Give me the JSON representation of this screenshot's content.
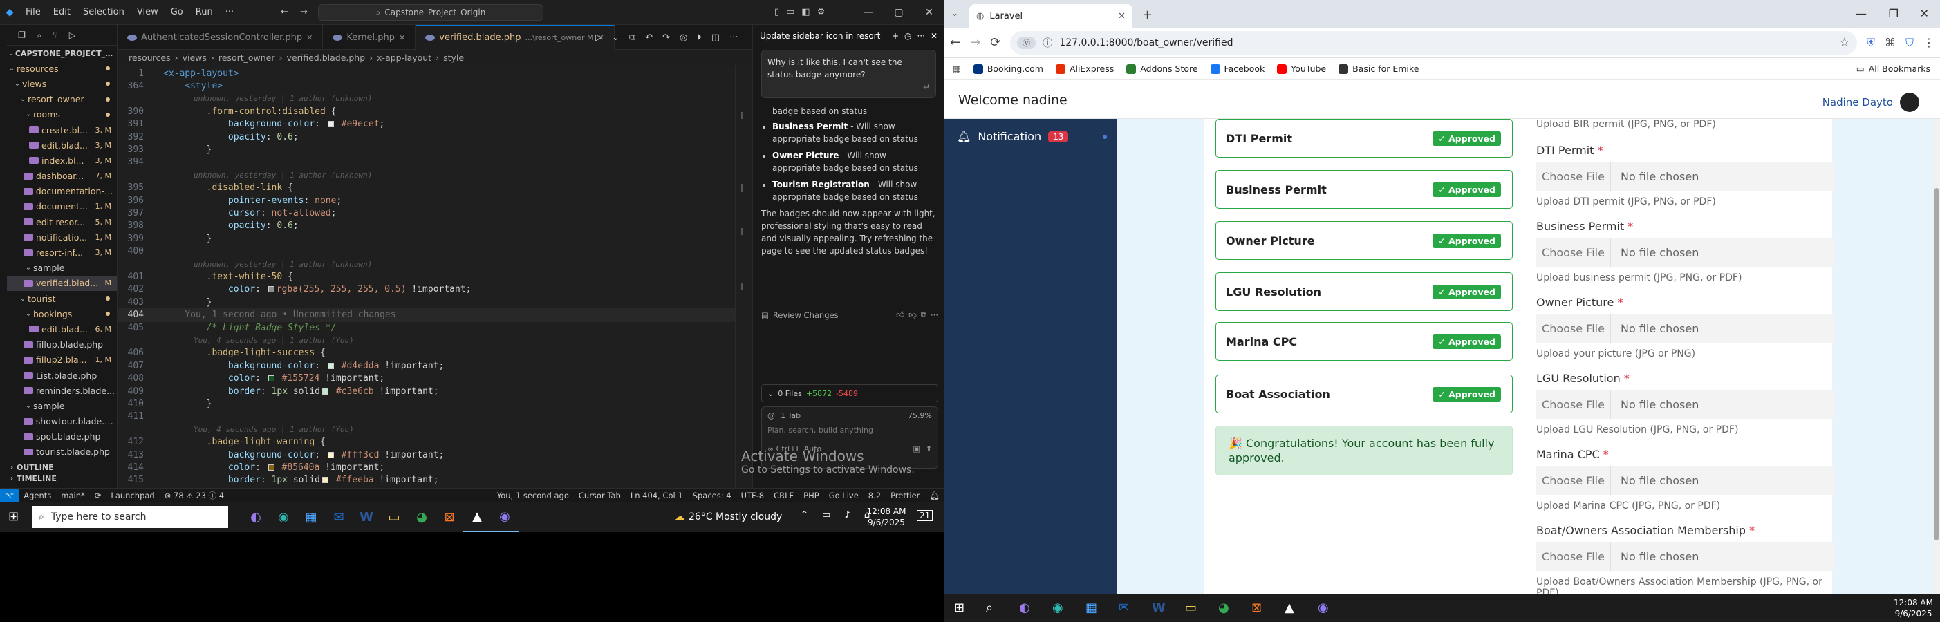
{
  "vscode": {
    "menu": [
      "File",
      "Edit",
      "Selection",
      "View",
      "Go",
      "Run",
      "···"
    ],
    "search": "Capstone_Project_Origin",
    "explorer": {
      "root": "CAPSTONE_PROJECT_ORIG...",
      "rows": [
        {
          "label": "resources",
          "indent": 0,
          "type": "folder",
          "mod": true,
          "badge": ""
        },
        {
          "label": "views",
          "indent": 1,
          "type": "folder",
          "mod": true,
          "badge": ""
        },
        {
          "label": "resort_owner",
          "indent": 2,
          "type": "folder",
          "mod": true,
          "badge": ""
        },
        {
          "label": "rooms",
          "indent": 3,
          "type": "folder",
          "mod": true,
          "badge": ""
        },
        {
          "label": "create.bl...",
          "indent": 4,
          "type": "file",
          "mod": true,
          "badge": "3, M"
        },
        {
          "label": "edit.blad...",
          "indent": 4,
          "type": "file",
          "mod": true,
          "badge": "3, M"
        },
        {
          "label": "index.bl...",
          "indent": 4,
          "type": "file",
          "mod": true,
          "badge": "3, M"
        },
        {
          "label": "dashboar...",
          "indent": 3,
          "type": "file",
          "mod": true,
          "badge": "7, M"
        },
        {
          "label": "documentation-p...",
          "indent": 3,
          "type": "file",
          "mod": true,
          "badge": ""
        },
        {
          "label": "document...",
          "indent": 3,
          "type": "file",
          "mod": true,
          "badge": "1, M"
        },
        {
          "label": "edit-resor...",
          "indent": 3,
          "type": "file",
          "mod": true,
          "badge": "5, M"
        },
        {
          "label": "notificatio...",
          "indent": 3,
          "type": "file",
          "mod": true,
          "badge": "1, M"
        },
        {
          "label": "resort-inf...",
          "indent": 3,
          "type": "file",
          "mod": true,
          "badge": "3, M"
        },
        {
          "label": "sample",
          "indent": 3,
          "type": "folder",
          "mod": false,
          "badge": ""
        },
        {
          "label": "verified.blad...",
          "indent": 3,
          "type": "file",
          "mod": true,
          "badge": "M",
          "active": true
        },
        {
          "label": "tourist",
          "indent": 2,
          "type": "folder",
          "mod": true,
          "badge": ""
        },
        {
          "label": "bookings",
          "indent": 3,
          "type": "folder",
          "mod": true,
          "badge": ""
        },
        {
          "label": "edit.blad...",
          "indent": 4,
          "type": "file",
          "mod": true,
          "badge": "6, M"
        },
        {
          "label": "fillup.blade.php",
          "indent": 3,
          "type": "file",
          "mod": false,
          "badge": ""
        },
        {
          "label": "fillup2.bla...",
          "indent": 3,
          "type": "file",
          "mod": true,
          "badge": "1, M"
        },
        {
          "label": "List.blade.php",
          "indent": 3,
          "type": "file",
          "mod": false,
          "badge": ""
        },
        {
          "label": "reminders.blade...",
          "indent": 3,
          "type": "file",
          "mod": false,
          "badge": ""
        },
        {
          "label": "sample",
          "indent": 3,
          "type": "folder",
          "mod": false,
          "badge": ""
        },
        {
          "label": "showtour.blade.p...",
          "indent": 3,
          "type": "file",
          "mod": false,
          "badge": ""
        },
        {
          "label": "spot.blade.php",
          "indent": 3,
          "type": "file",
          "mod": false,
          "badge": ""
        },
        {
          "label": "tourist.blade.php",
          "indent": 3,
          "type": "file",
          "mod": false,
          "badge": ""
        }
      ],
      "outline": "OUTLINE",
      "timeline": "TIMELINE"
    },
    "tabs": [
      {
        "label": "AuthenticatedSessionController.php",
        "active": false
      },
      {
        "label": "Kernel.php",
        "active": false
      },
      {
        "label": "verified.blade.php",
        "extra": "...\\resort_owner M",
        "active": true
      }
    ],
    "breadcrumb": [
      "resources",
      "views",
      "resort_owner",
      "verified.blade.php",
      "x-app-layout",
      "style"
    ],
    "code": [
      {
        "ln": "1",
        "html": "<span class='c-tag'>&lt;x-app-layout&gt;</span>"
      },
      {
        "ln": "364",
        "html": "    <span class='c-tag'>&lt;style&gt;</span>"
      },
      {
        "ln": "",
        "blame": "unknown, yesterday | 1 author (unknown)"
      },
      {
        "ln": "390",
        "html": "        <span class='c-sel'>.form-control:disabled</span> {"
      },
      {
        "ln": "391",
        "html": "            <span class='c-prop'>background-color</span>: <span class='sw' style='background:#e9ecef'></span> <span class='c-val'>#e9ecef</span>;"
      },
      {
        "ln": "392",
        "html": "            <span class='c-prop'>opacity</span>: <span class='c-num'>0.6</span>;"
      },
      {
        "ln": "393",
        "html": "        }"
      },
      {
        "ln": "394",
        "html": ""
      },
      {
        "ln": "",
        "blame": "unknown, yesterday | 1 author (unknown)"
      },
      {
        "ln": "395",
        "html": "        <span class='c-sel'>.disabled-link</span> {"
      },
      {
        "ln": "396",
        "html": "            <span class='c-prop'>pointer-events</span>: <span class='c-val'>none</span>;"
      },
      {
        "ln": "397",
        "html": "            <span class='c-prop'>cursor</span>: <span class='c-val'>not-allowed</span>;"
      },
      {
        "ln": "398",
        "html": "            <span class='c-prop'>opacity</span>: <span class='c-num'>0.6</span>;"
      },
      {
        "ln": "399",
        "html": "        }"
      },
      {
        "ln": "400",
        "html": ""
      },
      {
        "ln": "",
        "blame": "unknown, yesterday | 1 author (unknown)"
      },
      {
        "ln": "401",
        "html": "        <span class='c-sel'>.text-white-50</span> {"
      },
      {
        "ln": "402",
        "html": "            <span class='c-prop'>color</span>: <span class='sw' style='background:#ffffff80'></span><span class='c-val'>rgba(255, 255, 255, 0.5)</span> !important;"
      },
      {
        "ln": "403",
        "html": "        }"
      },
      {
        "ln": "404",
        "html": "    <span style='color:#6e6e6e'>You, 1 second ago • Uncommitted changes</span>",
        "cur": true
      },
      {
        "ln": "405",
        "html": "        <span class='c-com'>/* Light Badge Styles */</span>"
      },
      {
        "ln": "",
        "blame": "You, 4 seconds ago | 1 author (You)"
      },
      {
        "ln": "406",
        "html": "        <span class='c-sel'>.badge-light-success</span> {"
      },
      {
        "ln": "407",
        "html": "            <span class='c-prop'>background-color</span>: <span class='sw' style='background:#d4edda'></span> <span class='c-val'>#d4edda</span> !important;"
      },
      {
        "ln": "408",
        "html": "            <span class='c-prop'>color</span>: <span class='sw' style='background:#155724'></span> <span class='c-val'>#155724</span> !important;"
      },
      {
        "ln": "409",
        "html": "            <span class='c-prop'>border</span>: <span class='c-num'>1px</span> solid<span class='sw' style='background:#c3e6cb'></span> <span class='c-val'>#c3e6cb</span> !important;"
      },
      {
        "ln": "410",
        "html": "        }"
      },
      {
        "ln": "411",
        "html": ""
      },
      {
        "ln": "",
        "blame": "You, 4 seconds ago | 1 author (You)"
      },
      {
        "ln": "412",
        "html": "        <span class='c-sel'>.badge-light-warning</span> {"
      },
      {
        "ln": "413",
        "html": "            <span class='c-prop'>background-color</span>: <span class='sw' style='background:#fff3cd'></span> <span class='c-val'>#fff3cd</span> !important;"
      },
      {
        "ln": "414",
        "html": "            <span class='c-prop'>color</span>: <span class='sw' style='background:#85640a'></span> <span class='c-val'>#85640a</span> !important;"
      },
      {
        "ln": "415",
        "html": "            <span class='c-prop'>border</span>: <span class='c-num'>1px</span> solid<span class='sw' style='background:#ffeeba'></span> <span class='c-val'>#ffeeba</span> !important;"
      }
    ],
    "chat": {
      "title": "Update sidebar icon in resort",
      "question": "Why is it like this, I can't see the status badge anymore?",
      "lead": "badge based on status",
      "bullets": [
        {
          "strong": "Business Permit",
          "text": " - Will show appropriate badge based on status"
        },
        {
          "strong": "Owner Picture",
          "text": " - Will show appropriate badge based on status"
        },
        {
          "strong": "Tourism Registration",
          "text": " - Will show appropriate badge based on status"
        }
      ],
      "summary": "The badges should now appear with light, professional styling that's easy to read and visually appealing. Try refreshing the page to see the updated status badges!",
      "review": "Review Changes",
      "files": "0 Files",
      "added": "+5872",
      "removed": "-5489",
      "tab_count": "1 Tab",
      "percent": "75.9%",
      "placeholder": "Plan, search, build anything",
      "mode_key": "∞ Ctrl+I",
      "mode": "Auto"
    },
    "activate_title": "Activate Windows",
    "activate_sub": "Go to Settings to activate Windows.",
    "status": {
      "agents": "Agents",
      "branch": "main*",
      "launchpad": "Launchpad",
      "problems": "⊗ 78 ⚠ 23 ⓘ 4",
      "blame": "You, 1 second ago",
      "cursor_tab": "Cursor Tab",
      "position": "Ln 404, Col 1",
      "spaces": "Spaces: 4",
      "encoding": "UTF-8",
      "eol": "CRLF",
      "lang": "PHP",
      "golive": "Go Live",
      "version": "8.2",
      "prettier": "Prettier"
    }
  },
  "taskbar_left": {
    "search": "Type here to search",
    "weather": "26°C  Mostly cloudy",
    "time": "12:08 AM",
    "date": "9/6/2025",
    "notif": "21"
  },
  "chrome": {
    "tab_title": "Laravel",
    "url": "127.0.0.1:8000/boat_owner/verified",
    "bookmarks": [
      {
        "label": "Booking.com",
        "color": "#003580"
      },
      {
        "label": "AliExpress",
        "color": "#e62e04"
      },
      {
        "label": "Addons Store",
        "color": "#2e7d32"
      },
      {
        "label": "Facebook",
        "color": "#1877f2"
      },
      {
        "label": "YouTube",
        "color": "#ff0000"
      },
      {
        "label": "Basic for Emike",
        "color": "#333333"
      }
    ],
    "all_bookmarks": "All Bookmarks",
    "welcome": "Welcome nadine",
    "user": "Nadine Dayto",
    "notif_label": "Notification",
    "notif_count": "13",
    "documents": [
      {
        "name": "DTI Permit",
        "status": "✓ Approved"
      },
      {
        "name": "Business Permit",
        "status": "✓ Approved"
      },
      {
        "name": "Owner Picture",
        "status": "✓ Approved"
      },
      {
        "name": "LGU Resolution",
        "status": "✓ Approved"
      },
      {
        "name": "Marina CPC",
        "status": "✓ Approved"
      },
      {
        "name": "Boat Association",
        "status": "✓ Approved"
      }
    ],
    "congrats": "🎉 Congratulations! Your account has been fully approved.",
    "top_hint": "Upload BIR permit (JPG, PNG, or PDF)",
    "uploads": [
      {
        "label": "DTI Permit",
        "hint": "Upload DTI permit (JPG, PNG, or PDF)"
      },
      {
        "label": "Business Permit",
        "hint": "Upload business permit (JPG, PNG, or PDF)"
      },
      {
        "label": "Owner Picture",
        "hint": "Upload your picture (JPG or PNG)"
      },
      {
        "label": "LGU Resolution",
        "hint": "Upload LGU Resolution (JPG, PNG, or PDF)"
      },
      {
        "label": "Marina CPC",
        "hint": "Upload Marina CPC (JPG, PNG, or PDF)"
      },
      {
        "label": "Boat/Owners Association Membership",
        "hint": "Upload Boat/Owners Association Membership (JPG, PNG, or PDF)"
      }
    ],
    "choose_file": "Choose File",
    "no_file": "No file chosen",
    "required_mark": "*"
  },
  "taskbar_right": {
    "time": "12:08 AM",
    "date": "9/6/2025"
  }
}
